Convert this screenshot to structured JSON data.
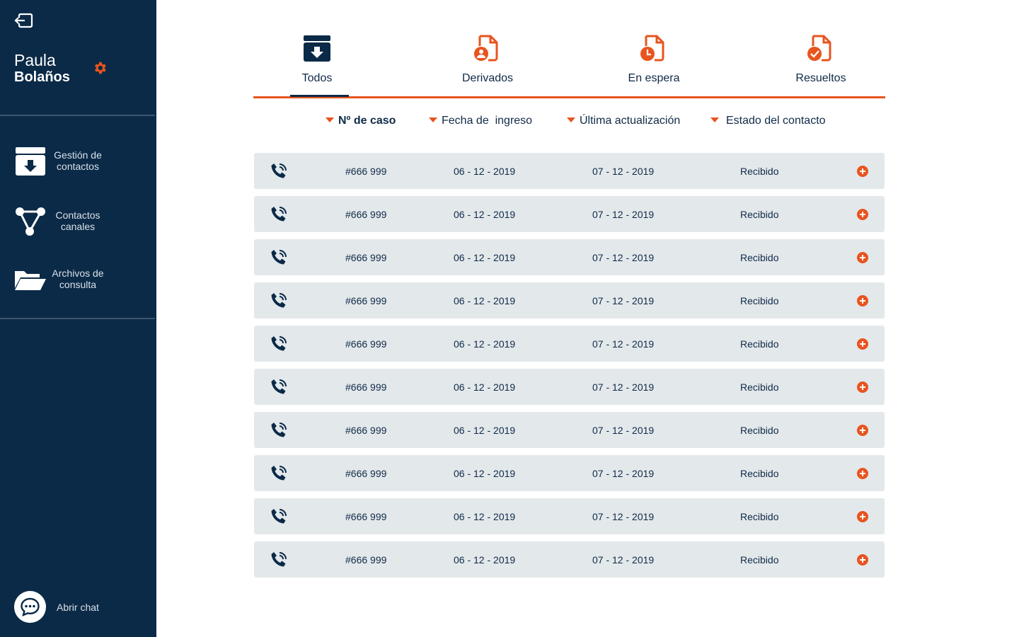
{
  "user": {
    "first_name": "Paula",
    "last_name": "Bolaños"
  },
  "sidebar": {
    "items": [
      {
        "label": "Gestión de contactos",
        "icon": "archive-download-icon"
      },
      {
        "label": "Contactos canales",
        "icon": "network-nodes-icon"
      },
      {
        "label": "Archivos de consulta",
        "icon": "folder-open-icon"
      }
    ],
    "chat_label": "Abrir chat"
  },
  "tabs": [
    {
      "label": "Todos",
      "icon": "archive-download-icon",
      "active": true
    },
    {
      "label": "Derivados",
      "icon": "document-user-icon",
      "active": false
    },
    {
      "label": "En espera",
      "icon": "document-clock-icon",
      "active": false
    },
    {
      "label": "Resueltos",
      "icon": "document-check-icon",
      "active": false
    }
  ],
  "columns": {
    "caso": "Nº de caso",
    "fecha": "Fecha de  ingreso",
    "ultima": "Última actualización",
    "estado": "Estado del contacto"
  },
  "rows": [
    {
      "caso": "#666 999",
      "fecha": "06 - 12 - 2019",
      "ultima": "07 - 12 - 2019",
      "estado": "Recibido"
    },
    {
      "caso": "#666 999",
      "fecha": "06 - 12 - 2019",
      "ultima": "07 - 12 - 2019",
      "estado": "Recibido"
    },
    {
      "caso": "#666 999",
      "fecha": "06 - 12 - 2019",
      "ultima": "07 - 12 - 2019",
      "estado": "Recibido"
    },
    {
      "caso": "#666 999",
      "fecha": "06 - 12 - 2019",
      "ultima": "07 - 12 - 2019",
      "estado": "Recibido"
    },
    {
      "caso": "#666 999",
      "fecha": "06 - 12 - 2019",
      "ultima": "07 - 12 - 2019",
      "estado": "Recibido"
    },
    {
      "caso": "#666 999",
      "fecha": "06 - 12 - 2019",
      "ultima": "07 - 12 - 2019",
      "estado": "Recibido"
    },
    {
      "caso": "#666 999",
      "fecha": "06 - 12 - 2019",
      "ultima": "07 - 12 - 2019",
      "estado": "Recibido"
    },
    {
      "caso": "#666 999",
      "fecha": "06 - 12 - 2019",
      "ultima": "07 - 12 - 2019",
      "estado": "Recibido"
    },
    {
      "caso": "#666 999",
      "fecha": "06 - 12 - 2019",
      "ultima": "07 - 12 - 2019",
      "estado": "Recibido"
    },
    {
      "caso": "#666 999",
      "fecha": "06 - 12 - 2019",
      "ultima": "07 - 12 - 2019",
      "estado": "Recibido"
    }
  ],
  "colors": {
    "sidebar_bg": "#0b2a47",
    "accent": "#e8541e",
    "row_bg": "#e3e8eb",
    "text": "#0f2a47"
  }
}
